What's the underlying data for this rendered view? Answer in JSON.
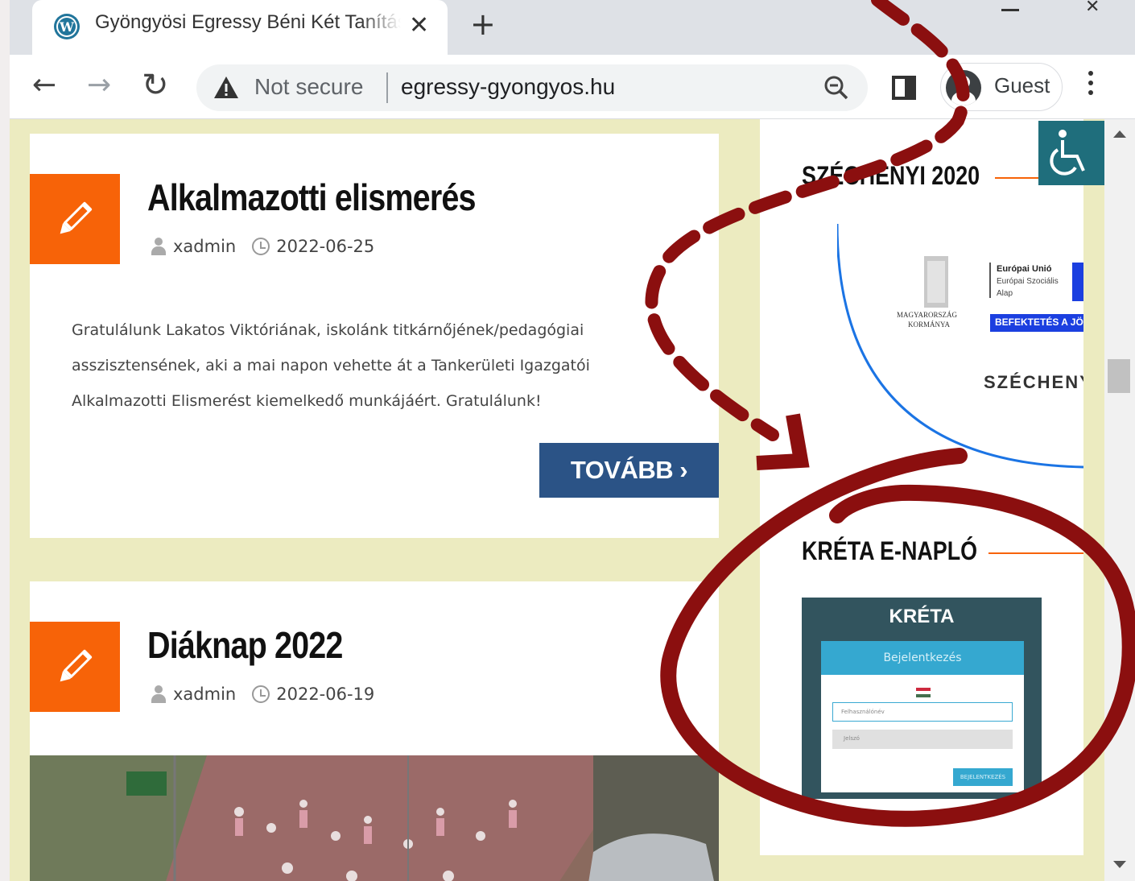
{
  "browser": {
    "tab_title": "Gyöngyösi Egressy Béni Két Tanítási",
    "tab_close": "✕",
    "new_tab": "+",
    "nav": {
      "back": "←",
      "forward": "→",
      "reload": "↻"
    },
    "security_label": "Not secure",
    "url": "egressy-gyongyos.hu",
    "profile_label": "Guest",
    "icons": [
      "wordpress-icon",
      "warning-icon",
      "zoom-icon",
      "side-panel-icon",
      "guest-avatar-icon",
      "menu-icon"
    ]
  },
  "posts": [
    {
      "title": "Alkalmazotti elismerés",
      "author": "xadmin",
      "date": "2022-06-25",
      "excerpt": "Gratulálunk Lakatos Viktóriának, iskolánk titkárnőjének/pedagógiai asszisztensének, aki a mai napon vehette át a Tankerületi Igazgatói Alkalmazotti Elismerést kiemelkedő munkájáért. Gratulálunk!",
      "more_label": "TOVÁBB ›"
    },
    {
      "title": "Diáknap 2022",
      "author": "xadmin",
      "date": "2022-06-19"
    }
  ],
  "sidebar": {
    "szechenyi": {
      "title": "SZÉCHENYI 2020",
      "eu_line1": "Európai Unió",
      "eu_line2": "Európai Szociális",
      "eu_line3": "Alap",
      "gov_line1": "MAGYARORSZÁG",
      "gov_line2": "KORMÁNYA",
      "invest": "BEFEKTETÉS A JÖVŐBE",
      "brand": "SZÉCHENYI"
    },
    "kreta": {
      "title": "KRÉTA E-NAPLÓ",
      "logo": "KRÉTA",
      "panel_title": "Bejelentkezés",
      "username_placeholder": "Felhasználónév",
      "password_placeholder": "Jelszó",
      "login_label": "BEJELENTKEZÉS"
    }
  },
  "colors": {
    "accent_orange": "#f76308",
    "button_blue": "#2b5386",
    "page_bg": "#ecebc0",
    "annotation_red": "#8b0f0f"
  }
}
